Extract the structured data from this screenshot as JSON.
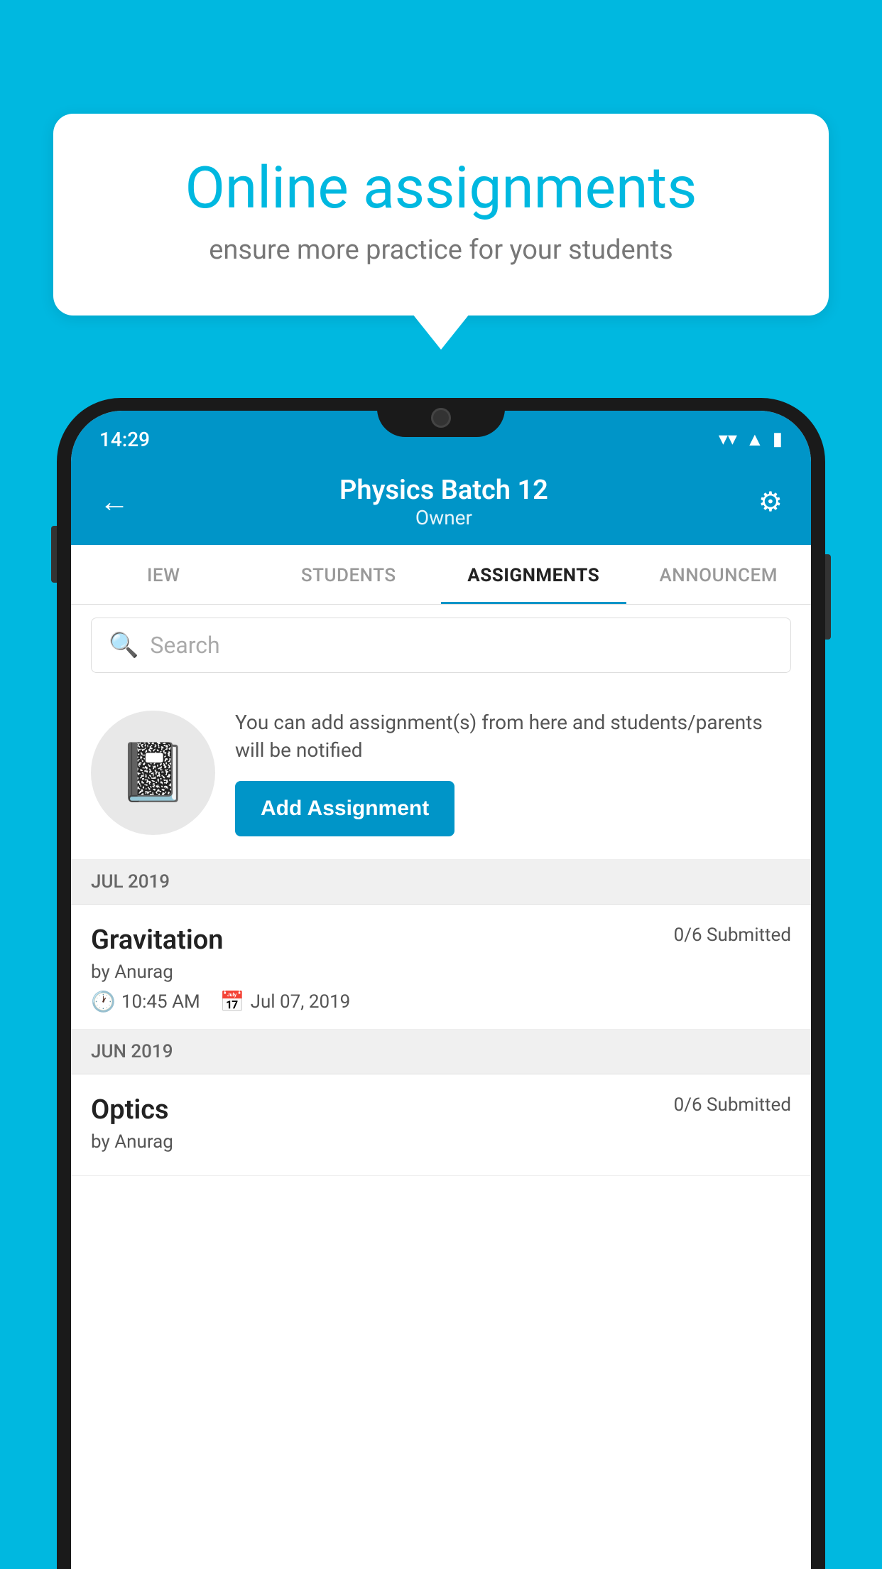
{
  "background": {
    "color": "#00b8e0"
  },
  "speech_bubble": {
    "title": "Online assignments",
    "subtitle": "ensure more practice for your students"
  },
  "status_bar": {
    "time": "14:29",
    "wifi": "▼",
    "signal": "▲",
    "battery": "▮"
  },
  "header": {
    "title": "Physics Batch 12",
    "subtitle": "Owner",
    "back_label": "←",
    "settings_label": "⚙"
  },
  "tabs": [
    {
      "label": "IEW",
      "active": false
    },
    {
      "label": "STUDENTS",
      "active": false
    },
    {
      "label": "ASSIGNMENTS",
      "active": true
    },
    {
      "label": "ANNOUNCEM",
      "active": false
    }
  ],
  "search": {
    "placeholder": "Search"
  },
  "promo": {
    "text": "You can add assignment(s) from here and students/parents will be notified",
    "button_label": "Add Assignment"
  },
  "sections": [
    {
      "label": "JUL 2019",
      "assignments": [
        {
          "title": "Gravitation",
          "submitted": "0/6 Submitted",
          "author": "by Anurag",
          "time": "10:45 AM",
          "date": "Jul 07, 2019"
        }
      ]
    },
    {
      "label": "JUN 2019",
      "assignments": [
        {
          "title": "Optics",
          "submitted": "0/6 Submitted",
          "author": "by Anurag",
          "time": "",
          "date": ""
        }
      ]
    }
  ]
}
